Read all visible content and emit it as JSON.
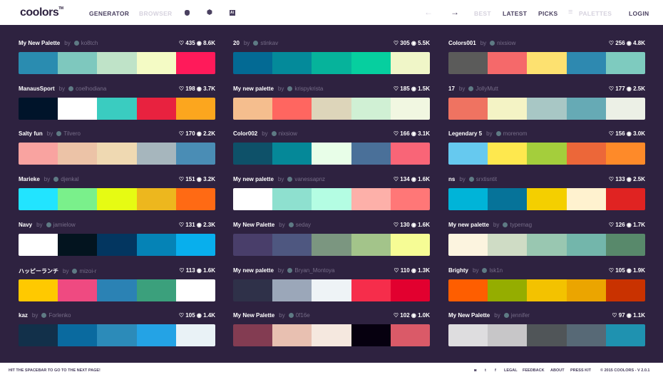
{
  "header": {
    "logo": "coolors",
    "logo_tm": "TM",
    "nav": {
      "generator": "GENERATOR",
      "browser": "BROWSER",
      "apple": "",
      "android": "⬢",
      "adobe": "Ai",
      "prev": "←",
      "next": "→",
      "best": "BEST",
      "latest": "LATEST",
      "picks": "PICKS",
      "palettes_icon": "≡",
      "palettes": "PALETTES",
      "login": "LOGIN"
    }
  },
  "by_label": "by",
  "palettes": [
    [
      {
        "name": "My New Palette",
        "user": "ko8tch",
        "likes": "435",
        "views": "8.6K",
        "colors": [
          "#2a8cb0",
          "#7ec8be",
          "#bfe3c8",
          "#f4fbc5",
          "#ff1a5a"
        ]
      },
      {
        "name": "ManausSport",
        "user": "coelhodiana",
        "likes": "198",
        "views": "3.7K",
        "colors": [
          "#00142a",
          "#ffffff",
          "#3accc0",
          "#e8223f",
          "#fca61e"
        ]
      },
      {
        "name": "Salty fun",
        "user": "Tilvero",
        "likes": "170",
        "views": "2.2K",
        "colors": [
          "#f9a3a0",
          "#ecc3a7",
          "#efd9b2",
          "#a6b6bd",
          "#4a8db5"
        ]
      },
      {
        "name": "Marieke",
        "user": "djenkal",
        "likes": "151",
        "views": "3.2K",
        "colors": [
          "#22e4ff",
          "#7af08b",
          "#e6fb13",
          "#edb71e",
          "#ff6a14"
        ]
      },
      {
        "name": "Navy",
        "user": "jamielow",
        "likes": "131",
        "views": "2.3K",
        "colors": [
          "#ffffff",
          "#03141f",
          "#033660",
          "#0583b6",
          "#08afed"
        ]
      },
      {
        "name": "ハッピーランチ",
        "user": "mizoi-r",
        "likes": "113",
        "views": "1.6K",
        "colors": [
          "#ffc900",
          "#ef4a81",
          "#2b82b4",
          "#3ba07c",
          "#ffffff"
        ]
      },
      {
        "name": "kaz",
        "user": "Forlenko",
        "likes": "105",
        "views": "1.4K",
        "colors": [
          "#12304a",
          "#0a6a9f",
          "#2c8bb9",
          "#24a3e5",
          "#e9f2f6"
        ]
      }
    ],
    [
      {
        "name": "20",
        "user": "stinkav",
        "likes": "305",
        "views": "5.5K",
        "colors": [
          "#036a94",
          "#048a9a",
          "#06b39b",
          "#06cf9f",
          "#f0f6c8"
        ]
      },
      {
        "name": "My new palette",
        "user": "krispykrista",
        "likes": "185",
        "views": "1.5K",
        "colors": [
          "#f5be8e",
          "#ff6660",
          "#ddd5ba",
          "#d0f0d4",
          "#f1f7e1"
        ]
      },
      {
        "name": "Color002",
        "user": "nixsiow",
        "likes": "166",
        "views": "3.1K",
        "colors": [
          "#0e5169",
          "#058898",
          "#e8fee8",
          "#4a7099",
          "#f96577"
        ]
      },
      {
        "name": "My new palette",
        "user": "vanessapnz",
        "likes": "134",
        "views": "1.6K",
        "colors": [
          "#ffffff",
          "#8ee0cf",
          "#b4fde3",
          "#fdb0a9",
          "#ff7777"
        ]
      },
      {
        "name": "My New Palette",
        "user": "seday",
        "likes": "130",
        "views": "1.6K",
        "colors": [
          "#493e6a",
          "#4e5780",
          "#7b9680",
          "#a3c48a",
          "#f6fc95"
        ]
      },
      {
        "name": "My new palette",
        "user": "Bryan_Montoya",
        "likes": "110",
        "views": "1.3K",
        "colors": [
          "#2f3149",
          "#9ba7b9",
          "#eef3f6",
          "#f62d4b",
          "#e2002f"
        ]
      },
      {
        "name": "My New Palette",
        "user": "0f16e",
        "likes": "102",
        "views": "1.0K",
        "colors": [
          "#833c52",
          "#e8c0b1",
          "#f5e8df",
          "#06000f",
          "#da5a68"
        ]
      }
    ],
    [
      {
        "name": "Colors001",
        "user": "nixsiow",
        "likes": "256",
        "views": "4.8K",
        "colors": [
          "#5b5b5a",
          "#f5696a",
          "#fde170",
          "#2e89b0",
          "#7ecbbf"
        ]
      },
      {
        "name": "17",
        "user": "JollyMutt",
        "likes": "177",
        "views": "2.5K",
        "colors": [
          "#ef7361",
          "#f4f3c5",
          "#a8c7c5",
          "#66aab5",
          "#ecf0e6"
        ]
      },
      {
        "name": "Legendary 5",
        "user": "morenom",
        "likes": "156",
        "views": "3.0K",
        "colors": [
          "#66c9ef",
          "#fee84e",
          "#a4ce3c",
          "#ec6739",
          "#fe8a29"
        ]
      },
      {
        "name": "ns",
        "user": "srxtisntit",
        "likes": "133",
        "views": "2.5K",
        "colors": [
          "#00b4d8",
          "#067399",
          "#f4cf00",
          "#fff2cf",
          "#e02322"
        ]
      },
      {
        "name": "My new palette",
        "user": "typemag",
        "likes": "126",
        "views": "1.7K",
        "colors": [
          "#fcf4df",
          "#cfdcc5",
          "#99c7b1",
          "#73b6ab",
          "#58896b"
        ]
      },
      {
        "name": "Brighty",
        "user": "lsk1n",
        "likes": "105",
        "views": "1.9K",
        "colors": [
          "#fe5e00",
          "#95ad00",
          "#f3c200",
          "#eba500",
          "#c93200"
        ]
      },
      {
        "name": "My New Palette",
        "user": "jennifer",
        "likes": "97",
        "views": "1.1K",
        "colors": [
          "#dedddf",
          "#c7c6c8",
          "#505558",
          "#576976",
          "#1f92b0"
        ]
      }
    ]
  ],
  "footer": {
    "hint": "HIT THE SPACEBAR TO GO TO THE NEXT PAGE!",
    "instagram": "◙",
    "twitter": "t",
    "facebook": "f",
    "legal": "LEGAL",
    "feedback": "FEEDBACK",
    "about": "ABOUT",
    "presskit": "PRESS KIT",
    "copyright": "© 2015 COOLORS - V 2.0.1"
  }
}
